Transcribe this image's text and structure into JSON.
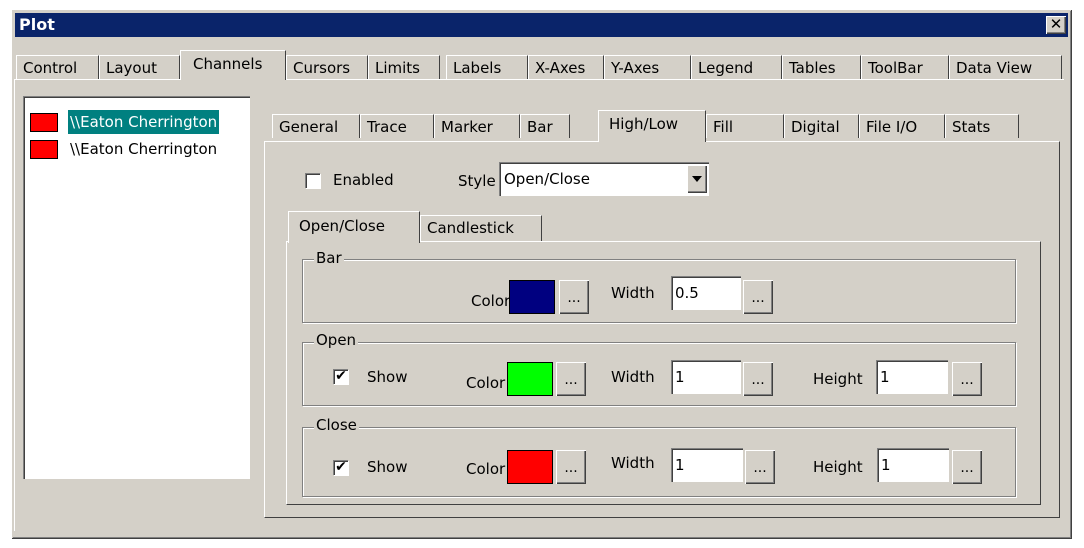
{
  "window": {
    "title": "Plot",
    "close_glyph": "✕"
  },
  "main_tabs": [
    "Control",
    "Layout",
    "Channels",
    "Cursors",
    "Limits",
    "Labels",
    "X-Axes",
    "Y-Axes",
    "Legend",
    "Tables",
    "ToolBar",
    "Data View"
  ],
  "active_main_tab": "Channels",
  "channels": [
    {
      "label": "\\\\Eaton Cherrington",
      "color": "#ff0000",
      "selected": true
    },
    {
      "label": "\\\\Eaton Cherrington",
      "color": "#ff0000",
      "selected": false
    }
  ],
  "sub_tabs": [
    "General",
    "Trace",
    "Marker",
    "Bar",
    "High/Low",
    "Fill",
    "Digital",
    "File I/O",
    "Stats"
  ],
  "active_sub_tab": "High/Low",
  "highlow": {
    "enabled_label": "Enabled",
    "enabled": false,
    "style_label": "Style",
    "style_value": "Open/Close",
    "style_tabs": [
      "Open/Close",
      "Candlestick"
    ],
    "active_style_tab": "Open/Close"
  },
  "bar": {
    "group_label": "Bar",
    "color_label": "Color",
    "color": "#000080",
    "width_label": "Width",
    "width_value": "0.5",
    "dots": "..."
  },
  "open": {
    "group_label": "Open",
    "show_label": "Show",
    "show": true,
    "color_label": "Color",
    "color": "#00ff00",
    "width_label": "Width",
    "width_value": "1",
    "height_label": "Height",
    "height_value": "1",
    "dots": "..."
  },
  "close": {
    "group_label": "Close",
    "show_label": "Show",
    "show": true,
    "color_label": "Color",
    "color": "#ff0000",
    "width_label": "Width",
    "width_value": "1",
    "height_label": "Height",
    "height_value": "1",
    "dots": "..."
  },
  "check_glyph": "✔"
}
